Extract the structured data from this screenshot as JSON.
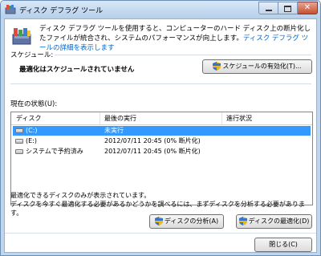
{
  "window": {
    "title": "ディスク デフラグ ツール"
  },
  "intro": {
    "text": "ディスク デフラグ ツールを使用すると、コンピューターのハード ディスク上の断片化したファイルが統合され、システムのパフォーマンスが向上します。",
    "link": "ディスク デフラグ ツールの詳細を表示します"
  },
  "schedule": {
    "label": "スケジュール:",
    "status": "最適化はスケジュールされていません",
    "enable_button": "スケジュールの有効化(T)..."
  },
  "current_state": {
    "label": "現在の状態(U):",
    "columns": [
      "ディスク",
      "最後の実行",
      "進行状況"
    ],
    "rows": [
      {
        "disk": "(C:)",
        "last_run": "未実行",
        "progress": ""
      },
      {
        "disk": "(E:)",
        "last_run": "2012/07/11 20:45 (0% 断片化)",
        "progress": ""
      },
      {
        "disk": "システムで予約済み",
        "last_run": "2012/07/11 20:45 (0% 断片化)",
        "progress": ""
      }
    ]
  },
  "notes": {
    "line1": "最適化できるディスクのみが表示されています。",
    "line2": "ディスクを今すぐ最適化する必要があるかどうかを調べるには、まずディスクを分析する必要があります。"
  },
  "actions": {
    "analyze_button": "ディスクの分析(A)",
    "defrag_button": "ディスクの最適化(D)",
    "close_button": "閉じる(C)"
  },
  "colors": {
    "selection": "#3399ff",
    "link": "#0066cc",
    "frame": "#bfd6ee"
  }
}
